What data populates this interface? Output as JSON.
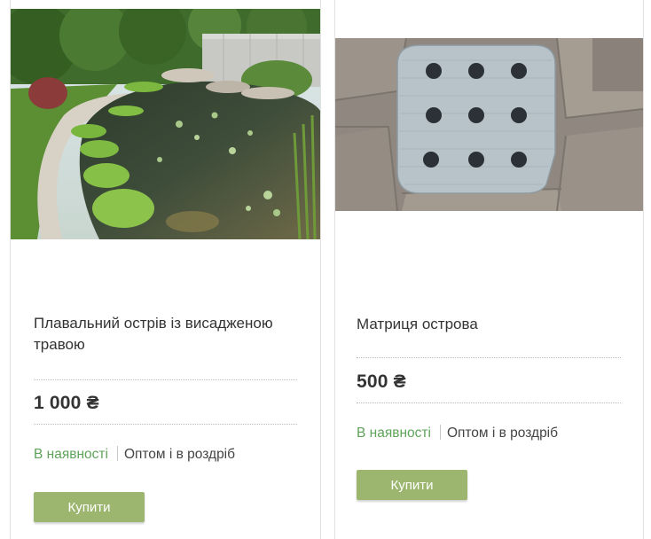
{
  "currency_symbol": "₴",
  "colors": {
    "in_stock": "#5fa35a",
    "button_bg": "#9cb670",
    "button_text": "#ffffff",
    "text": "#333333"
  },
  "products": [
    {
      "image_alt": "pond-with-floating-grass-islands",
      "title": "Плавальний острів із висадженою травою",
      "price": "1 000 ₴",
      "availability": "В наявності",
      "sale_type": "Оптом і в роздріб",
      "buy_label": "Купити"
    },
    {
      "image_alt": "island-matrix-mat-on-paving",
      "title": "Матриця острова",
      "price": "500 ₴",
      "availability": "В наявності",
      "sale_type": "Оптом і в роздріб",
      "buy_label": "Купити"
    }
  ]
}
